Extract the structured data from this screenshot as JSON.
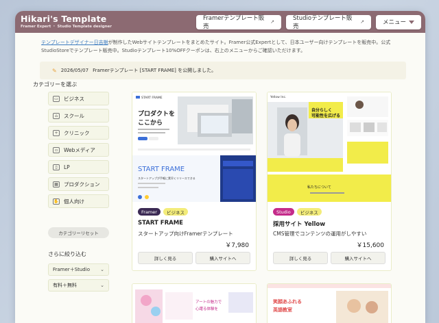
{
  "brand": {
    "title": "Hikari's Template",
    "subtitle": "Framer Expert ・ Studio Template designer"
  },
  "nav": {
    "framer": "Framerテンプレート販売",
    "studio": "Studioテンプレート販売",
    "menu": "メニュー"
  },
  "intro": {
    "link": "テンプレートデザイナー日吉樹",
    "text": "が制作したWebサイトテンプレートをまとめたサイト。Framer公式Expertとして、日本ユーザー向けテンプレートを販売中。公式StudioStoreでテンプレート販売中。Studioテンプレート10%OFFクーポンは、右上のメニューからご確認いただけます。"
  },
  "notice": {
    "date": "2026/05/07",
    "text": "Framerテンプレート [START FRAME] を公開しました。"
  },
  "sidebar": {
    "title": "カテゴリーを選ぶ",
    "categories": [
      "ビジネス",
      "スクール",
      "クリニック",
      "Webメディア",
      "LP",
      "プロダクション",
      "個人向け"
    ],
    "reset": "カテゴリーリセット",
    "filter_title": "さらに絞り込む",
    "filter1": "Framer＋Studio",
    "filter2": "有料＋無料"
  },
  "cards": [
    {
      "platform": "Framer",
      "category": "ビジネス",
      "title": "START FRAME",
      "desc": "スタートアップ向けFramerテンプレート",
      "price": "￥7,980",
      "details": "詳しく見る",
      "buy": "購入サイトへ",
      "thumb": {
        "brand": "START FRAME",
        "headline1": "プロダクトを",
        "headline2": "ここから",
        "big": "START FRAME",
        "sub": "スタートアップが手軽に素早くリリースできる"
      }
    },
    {
      "platform": "Studio",
      "category": "ビジネス",
      "title": "採用サイト Yellow",
      "desc": "CMS管理でコンテンツの運用がしやすい",
      "price": "￥15,600",
      "details": "詳しく見る",
      "buy": "購入サイトへ",
      "thumb": {
        "brand": "Yellow Inc.",
        "headline1": "自分らしく",
        "headline2": "可能性を広げる",
        "footer": "私たちについて"
      }
    }
  ],
  "lower_cards": [
    {
      "text1": "アートの魅力で",
      "text2": "心躍る体験を"
    },
    {
      "text1": "笑顔あふれる",
      "text2": "英語教室"
    }
  ],
  "colors": {
    "topbar": "#8c6a72",
    "framer_tag": "#3b2a54",
    "studio_tag": "#c42b8a",
    "biz_tag": "#f3ec7a"
  }
}
